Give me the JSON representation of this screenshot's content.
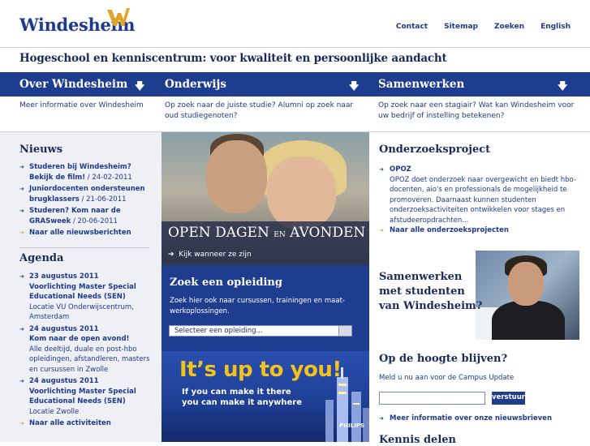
{
  "header": {
    "logo_text": "Windesheim",
    "topnav": [
      "Contact",
      "Sitemap",
      "Zoeken",
      "English"
    ]
  },
  "tagline": "Hogeschool en kenniscentrum: voor kwaliteit en persoonlijke aandacht",
  "nav": [
    {
      "title": "Over Windesheim",
      "desc": "Meer informatie over Windesheim"
    },
    {
      "title": "Onderwijs",
      "desc": "Op zoek naar de juiste studie? Alumni op zoek naar oud studiegenoten?"
    },
    {
      "title": "Samenwerken",
      "desc": "Op zoek naar een stagiair? Wat kan Windesheim voor uw bedrijf of instelling betekenen?"
    }
  ],
  "nieuws": {
    "title": "Nieuws",
    "items": [
      {
        "bold": "Studeren bij Windesheim? Bekijk de film!",
        "rest": " / 24-02-2011"
      },
      {
        "bold": "Juniordocenten ondersteunen brugklassers",
        "rest": " / 21-06-2011"
      },
      {
        "bold": "Studeren? Kom naar de GRASweek",
        "rest": " / 20-06-2011"
      }
    ],
    "more": "Naar alle nieuwsberichten"
  },
  "agenda": {
    "title": "Agenda",
    "items": [
      {
        "date": "23 augustus 2011",
        "title": "Voorlichting Master Special Educational Needs (SEN)",
        "desc": "Locatie VU Onderwijscentrum, Amsterdam"
      },
      {
        "date": "24 augustus 2011",
        "title": "Kom naar de open avond!",
        "desc": "Alle deeltijd, duale en post-hbo opleidingen, afstandleren, masters en cursussen in Zwolle"
      },
      {
        "date": "24 augustus 2011",
        "title": "Voorlichting Master Special Educational Needs (SEN)",
        "desc": "Locatie Zwolle"
      }
    ],
    "more": "Naar alle activiteiten"
  },
  "hero": {
    "title_a": "OPEN DAGEN",
    "title_en": "EN",
    "title_b": "AVONDEN",
    "link": "Kijk wanneer ze zijn"
  },
  "search": {
    "title": "Zoek een opleiding",
    "desc": "Zoek hier ook naar cursussen, trainingen en maat-werkoplossingen.",
    "select_value": "Selecteer een opleiding..."
  },
  "promo": {
    "title": "It’s up to you!",
    "line1": "If you can make it there",
    "line2": "you can make it anywhere",
    "brand": "PHILIPS"
  },
  "onderzoek": {
    "title": "Onderzoeksproject",
    "item_title": "OPOZ",
    "item_desc": "OPOZ doet onderzoek naar overgewicht en biedt hbo-docenten, aio's en professionals de mogelijkheid te promoveren. Daarnaast kunnen studenten onderzoeksactiviteiten ontwikkelen voor stages en afstudeeropdrachten...",
    "more": "Naar alle onderzoeksprojecten"
  },
  "samenwerken_banner": {
    "line1": "Samenwerken",
    "line2": "met studenten",
    "line3": "van Windesheim?"
  },
  "hoogte": {
    "title": "Op de hoogte blijven?",
    "desc": "Meld u nu aan voor de Campus Update",
    "button": "verstuur",
    "more": "Meer informatie over onze nieuwsbrieven"
  },
  "kennis": {
    "title": "Kennis delen"
  }
}
